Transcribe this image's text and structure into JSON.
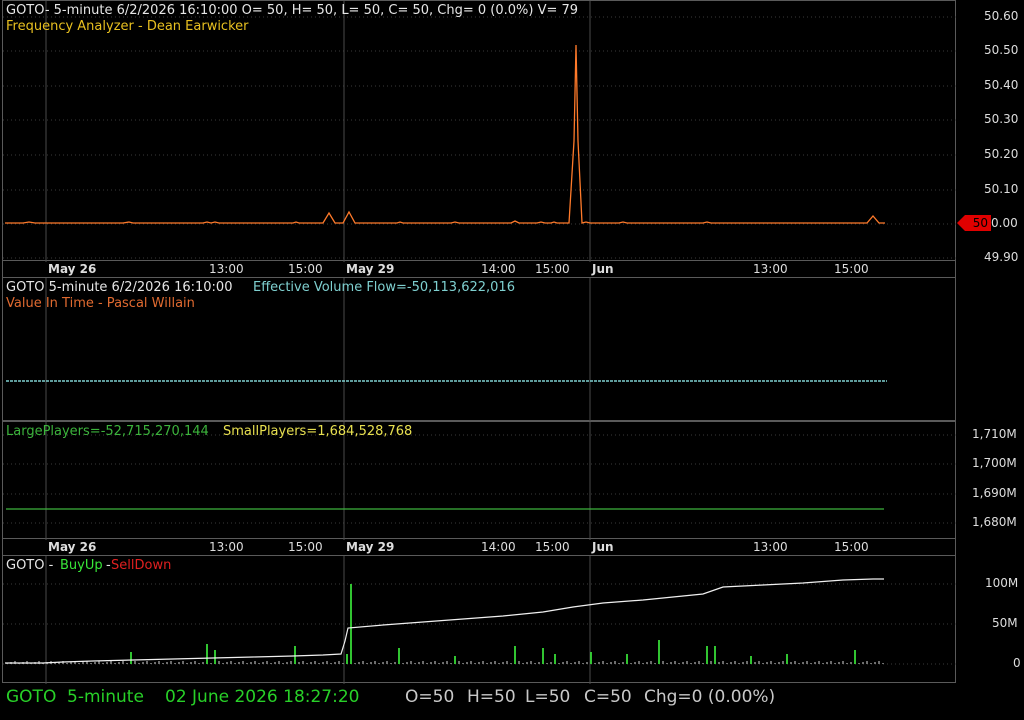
{
  "price_panel": {
    "header": "GOTO- 5-minute 6/2/2026 16:10:00 O= 50, H= 50, L= 50, C= 50, Chg= 0 (0.0%) V= 79",
    "subheader": "Frequency Analyzer - Dean Earwicker",
    "price_tag": "50",
    "y_labels": [
      "50.60",
      "50.50",
      "50.40",
      "50.30",
      "50.20",
      "50.10",
      "0.00",
      "49.90"
    ]
  },
  "date_axis": {
    "ticks": [
      "May 26",
      "13:00",
      "15:00",
      "May 29",
      "14:00",
      "15:00",
      "Jun",
      "13:00",
      "15:00"
    ]
  },
  "flow_panel": {
    "header_prefix": "GOTO 5-minute  6/2/2026 16:10:00",
    "header_value": "Effective Volume Flow=-50,113,622,016",
    "subheader": "Value In Time - Pascal Willain"
  },
  "players_panel": {
    "large_players": "LargePlayers=-52,715,270,144",
    "small_players": "SmallPlayers=1,684,528,768",
    "y_labels": [
      "1,710M",
      "1,700M",
      "1,690M",
      "1,680M"
    ]
  },
  "buysell_panel": {
    "title_prefix": "GOTO -",
    "buy_label": "BuyUp",
    "sep": "-",
    "sell_label": "SellDown",
    "y_labels": [
      "100M",
      "50M",
      "0"
    ]
  },
  "status_bar": {
    "symbol": "GOTO",
    "interval": "5-minute",
    "datetime": "02 June 2026 18:27:20",
    "open": "O=50",
    "high": "H=50",
    "low": "L=50",
    "close": "C=50",
    "change": "Chg=0 (0.00%)"
  },
  "colors": {
    "price_line": "#ff7a2a",
    "spike_line": "#ffd080",
    "flow_line": "#7fd0d0",
    "large_players": "#3cb43c",
    "small_players": "#e8e050",
    "buy": "#39e639",
    "sell": "#e02020",
    "status_green": "#28d028",
    "price_tag": "#e00000"
  }
}
